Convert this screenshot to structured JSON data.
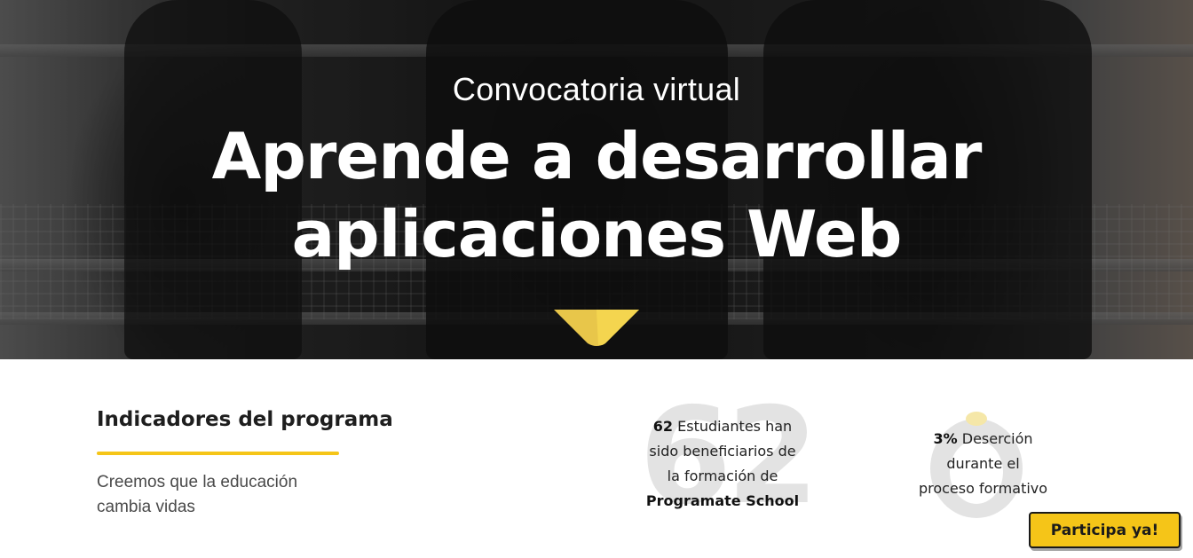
{
  "hero": {
    "subtitle": "Convocatoria virtual",
    "title_line1": "Aprende a desarrollar",
    "title_line2": "aplicaciones Web",
    "scroll_icon": "chevron-down-icon"
  },
  "indicators": {
    "title": "Indicadores del programa",
    "tagline_line1": "Creemos que la educación",
    "tagline_line2": "cambia vidas"
  },
  "stats": [
    {
      "background_number": "62",
      "value": "62",
      "line1_rest": " Estudiantes han",
      "line2": "sido beneficiarios de",
      "line3": "la formación de",
      "line4": "Programate School"
    },
    {
      "value": "3%",
      "line1_rest": " Deserción",
      "line2": "durante el",
      "line3": "proceso formativo"
    }
  ],
  "cta": {
    "label": "Participa ya!"
  },
  "colors": {
    "accent": "#f5c518",
    "hero_overlay": "#1a1a1a",
    "text_dark": "#1e1e1e",
    "watermark": "#e3e3e3"
  }
}
